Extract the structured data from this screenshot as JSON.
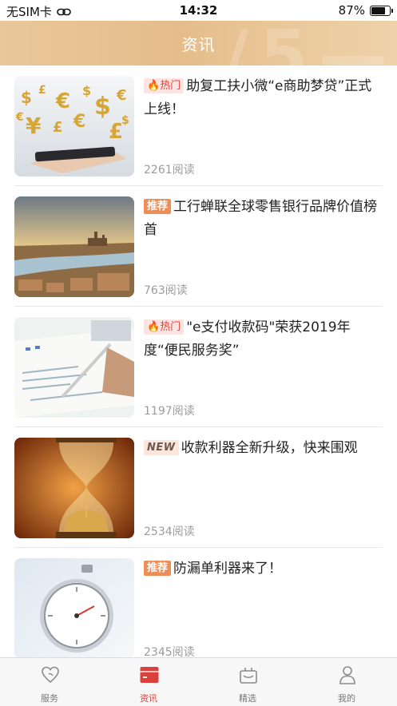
{
  "status_bar": {
    "carrier": "无SIM卡",
    "time": "14:32",
    "battery": "87%",
    "battery_level": 0.87
  },
  "header": {
    "title": "资讯"
  },
  "news": [
    {
      "tag": "热门",
      "tag_type": "hot",
      "title": "助复工扶小微“e商助梦贷”正式上线！",
      "reads": "2261阅读",
      "image": "currency-hand"
    },
    {
      "tag": "推荐",
      "tag_type": "rec",
      "title": "工行蝉联全球零售银行品牌价值榜首",
      "reads": "763阅读",
      "image": "city-river"
    },
    {
      "tag": "热门",
      "tag_type": "hot",
      "title": "\"e支付收款码\"荣获2019年度“便民服务奖”",
      "reads": "1197阅读",
      "image": "pen-charts"
    },
    {
      "tag": "NEW",
      "tag_type": "new",
      "title": "收款利器全新升级，快来围观",
      "reads": "2534阅读",
      "image": "hourglass"
    },
    {
      "tag": "推荐",
      "tag_type": "rec",
      "title": "防漏单利器来了！",
      "reads": "2345阅读",
      "image": "stopwatch"
    }
  ],
  "tabs": [
    {
      "label": "服务",
      "icon": "heart-icon",
      "active": false
    },
    {
      "label": "资讯",
      "icon": "news-card-icon",
      "active": true
    },
    {
      "label": "精选",
      "icon": "gift-bag-icon",
      "active": false
    },
    {
      "label": "我的",
      "icon": "user-icon",
      "active": false
    }
  ],
  "colors": {
    "accent": "#d9413f",
    "header": "#e5bd8b",
    "tag_recommend": "#ee8d56",
    "tag_hot": "#e2443b"
  }
}
